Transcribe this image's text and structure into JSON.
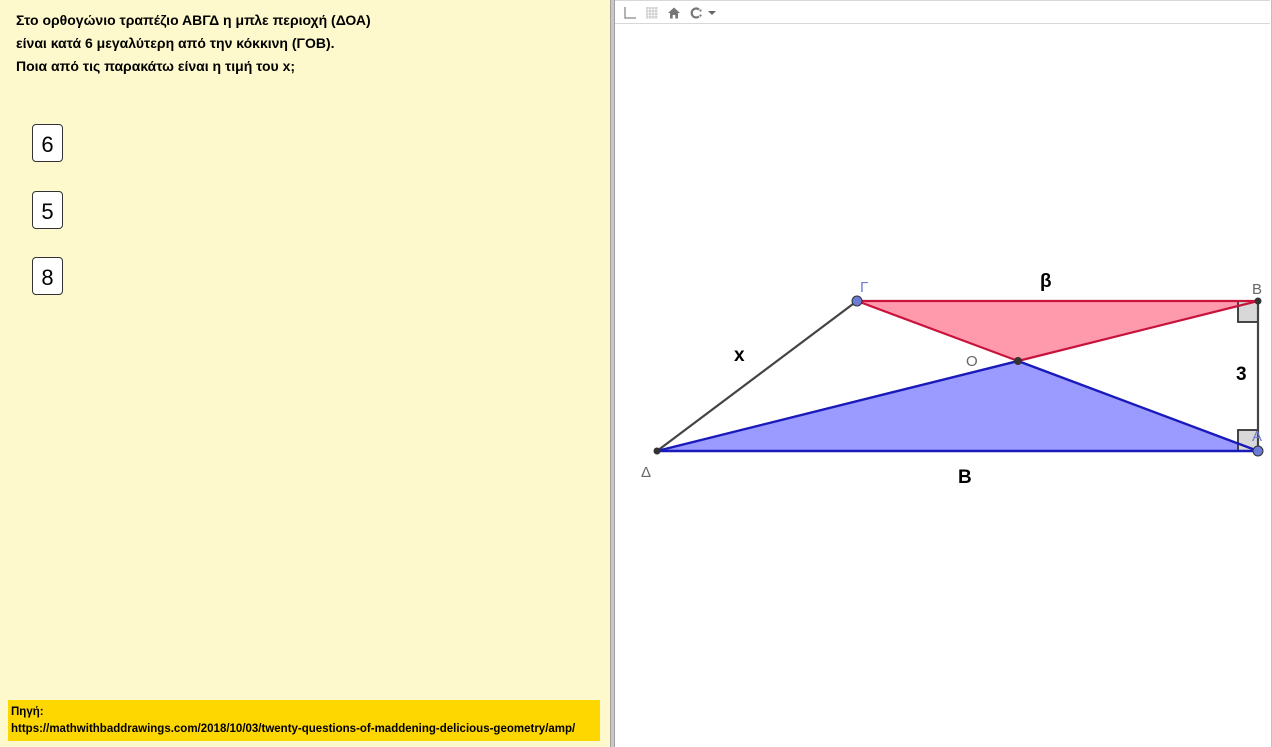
{
  "question": {
    "lines": [
      "Στο ορθογώνιο τραπέζιο ΑΒΓΔ  η μπλε περιοχή (ΔΟΑ)",
      "είναι κατά 6 μεγαλύτερη από την κόκκινη (ΓΟΒ).",
      "Ποια από τις παρακάτω είναι η τιμή του x;"
    ]
  },
  "answers": [
    "6",
    "5",
    "8"
  ],
  "source": {
    "label": "Πηγή:",
    "url": "https://mathwithbaddrawings.com/2018/10/03/twenty-questions-of-maddening-delicious-geometry/amp/"
  },
  "toolbar": {
    "icons": [
      "axes-icon",
      "grid-icon",
      "home-icon",
      "point-capturing-icon"
    ]
  },
  "geometry": {
    "point_labels": {
      "gamma": "Γ",
      "beta_vertex": "Β",
      "o": "Ο",
      "delta": "Δ",
      "alpha": "Α"
    },
    "segment_labels": {
      "x": "x",
      "top_base": "β",
      "bottom_base": "B",
      "height": "3"
    },
    "colors": {
      "red_fill": "#ff9aac",
      "red_stroke": "#c8143c",
      "blue_fill": "#9a9aff",
      "blue_stroke": "#1a1aba",
      "side": "#444444",
      "point_free": "#6b7bd6",
      "point_dependent": "#333333",
      "label_gray": "#666666"
    }
  }
}
